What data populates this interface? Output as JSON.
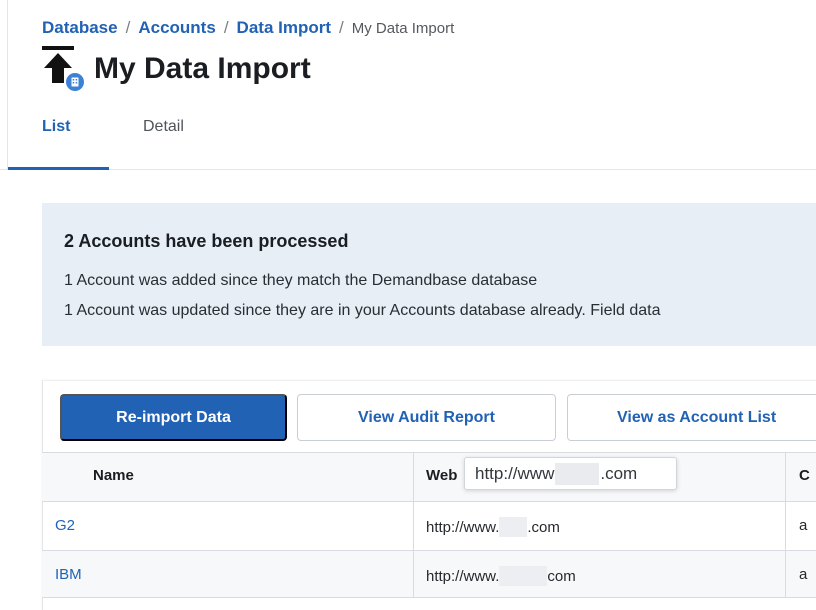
{
  "breadcrumb": {
    "items": [
      "Database",
      "Accounts",
      "Data Import"
    ],
    "separator": "/",
    "current": "My Data Import"
  },
  "page": {
    "title": "My Data Import",
    "icon": "upload-arrow-icon",
    "badge_icon": "building-icon"
  },
  "tabs": [
    {
      "label": "List",
      "active": true
    },
    {
      "label": "Detail",
      "active": false
    }
  ],
  "notice": {
    "heading": "2 Accounts have been processed",
    "lines": [
      "1 Account was added since they match the Demandbase database",
      "1 Account was updated since they are in your Accounts database already. Field data"
    ]
  },
  "actions": {
    "reimport_label": "Re-import Data",
    "audit_label": "View Audit Report",
    "account_list_label": "View as Account List"
  },
  "table": {
    "columns": [
      "Name",
      "Web",
      "C"
    ],
    "rows": [
      {
        "name": "G2",
        "web_prefix": "http://www.",
        "web_suffix": ".com",
        "third": "a"
      },
      {
        "name": "IBM",
        "web_prefix": "http://www.",
        "web_suffix": "com",
        "third": "a"
      }
    ]
  },
  "tooltip": {
    "prefix": "http://www",
    "suffix": ".com"
  },
  "colors": {
    "accent": "#2162b5",
    "notice_bg": "#e7eef6",
    "header_bg": "#f7f8f9"
  }
}
